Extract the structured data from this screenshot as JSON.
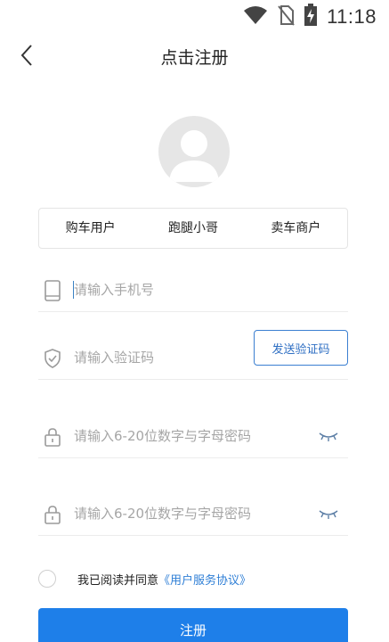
{
  "status_bar": {
    "time": "11:18",
    "icons": [
      "wifi-icon",
      "no-sim-icon",
      "battery-charging-icon"
    ]
  },
  "header": {
    "title": "点击注册",
    "back_icon": "chevron-left-icon"
  },
  "avatar": {
    "icon": "default-avatar-icon"
  },
  "roles": [
    {
      "label": "购车用户"
    },
    {
      "label": "跑腿小哥"
    },
    {
      "label": "卖车商户"
    }
  ],
  "form": {
    "phone": {
      "placeholder": "请输入手机号",
      "value": "",
      "icon": "phone-icon"
    },
    "code": {
      "placeholder": "请输入验证码",
      "value": "",
      "icon": "shield-check-icon",
      "send_label": "发送验证码"
    },
    "password": {
      "placeholder": "请输入6-20位数字与字母密码",
      "value": "",
      "icon": "lock-icon",
      "toggle_icon": "eye-closed-icon"
    },
    "confirm_password": {
      "placeholder": "请输入6-20位数字与字母密码",
      "value": "",
      "icon": "lock-icon",
      "toggle_icon": "eye-closed-icon"
    }
  },
  "agreement": {
    "checked": false,
    "text": "我已阅读并同意",
    "link": "《用户服务协议》"
  },
  "submit_label": "注册",
  "colors": {
    "accent": "#1e7fe9",
    "link": "#2f7fd6",
    "placeholder": "#a6a6a6",
    "divider": "#ececec"
  }
}
